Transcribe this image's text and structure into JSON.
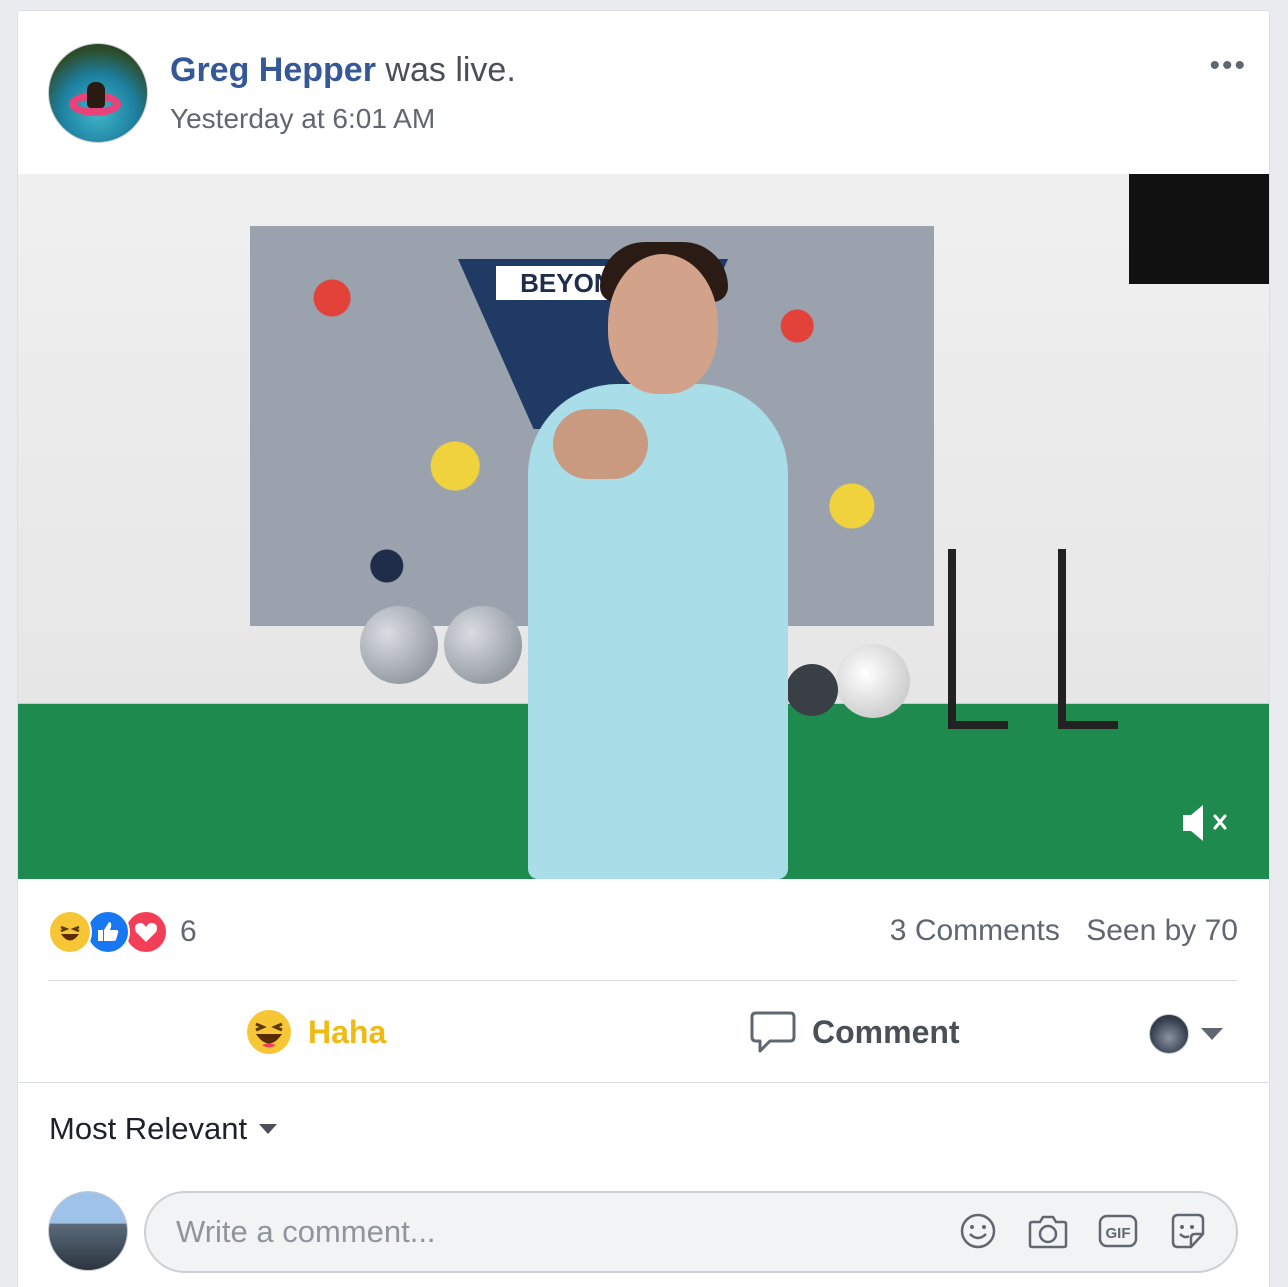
{
  "post": {
    "author": "Greg Hepper",
    "action": "was live.",
    "timestamp": "Yesterday at 6:01 AM",
    "more_label": "•••"
  },
  "video": {
    "sign_text": "BEYOND ST",
    "muted": true
  },
  "stats": {
    "reactions": [
      "haha-icon",
      "like-icon",
      "love-icon"
    ],
    "reaction_count": "6",
    "comments": "3 Comments",
    "seen_by": "Seen by 70"
  },
  "actions": {
    "haha_label": "Haha",
    "comment_label": "Comment"
  },
  "comments": {
    "sort_label": "Most Relevant",
    "input_placeholder": "Write a comment...",
    "icons": [
      "emoji-icon",
      "camera-icon",
      "gif-icon",
      "sticker-icon"
    ]
  },
  "colors": {
    "author_link": "#365899",
    "haha_active": "#f0ba15",
    "like_blue": "#1877f2",
    "love_red": "#f33e58"
  }
}
